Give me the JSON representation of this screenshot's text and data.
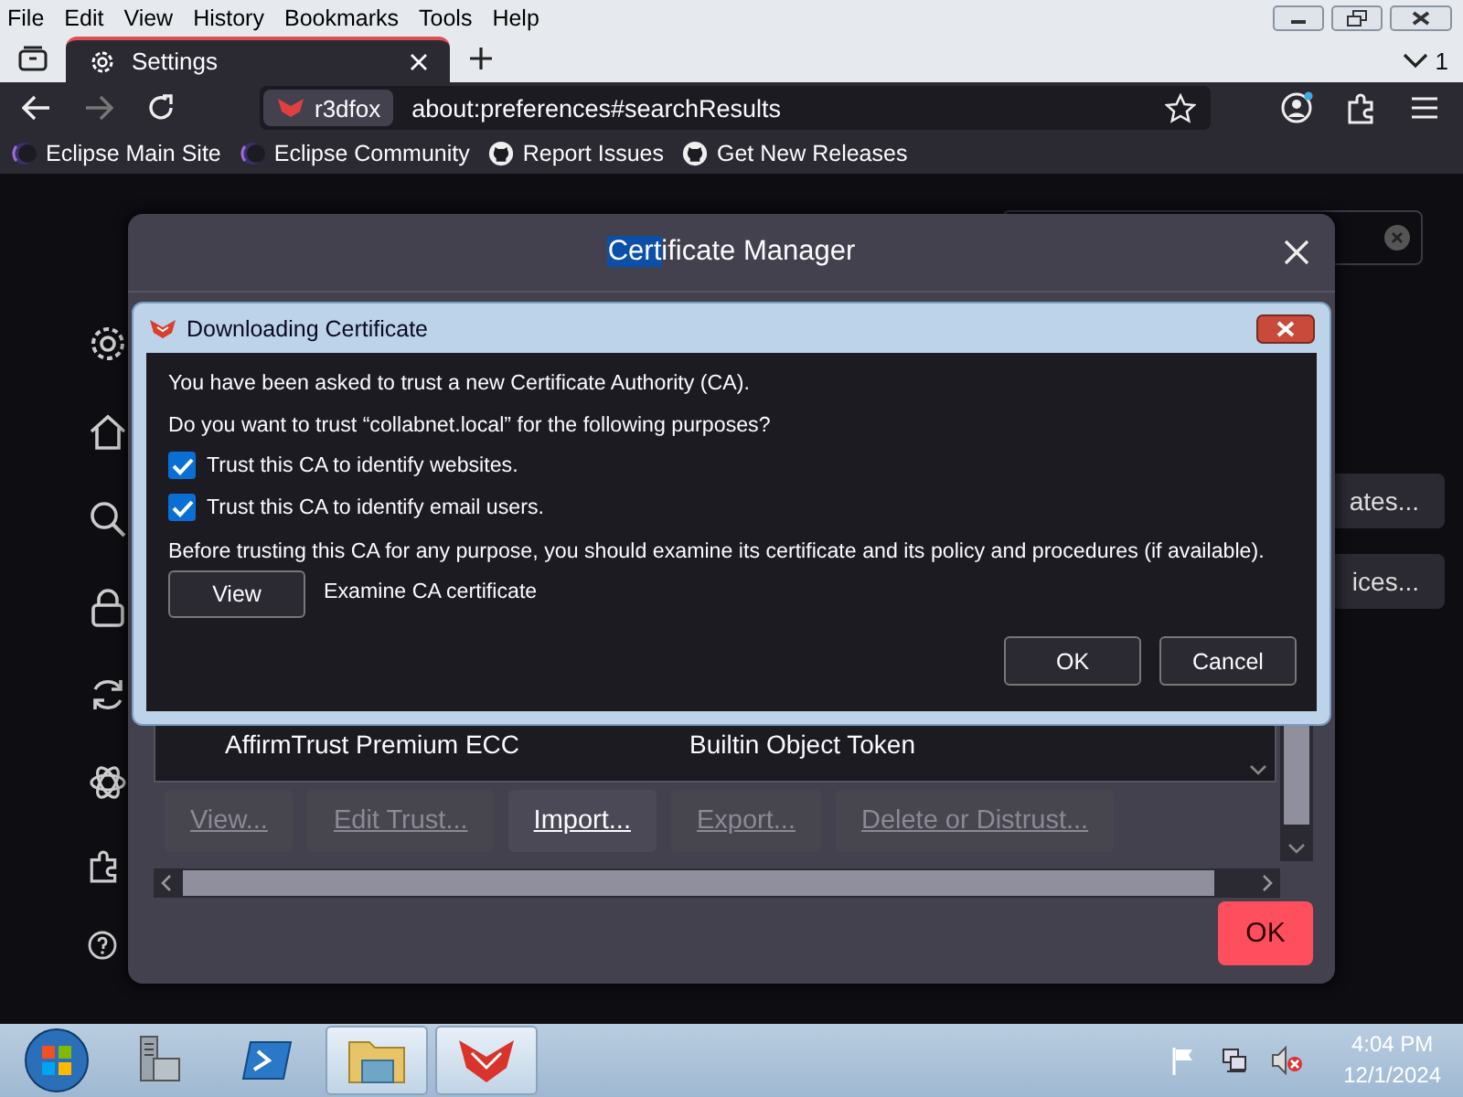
{
  "menu_bar": [
    "File",
    "Edit",
    "View",
    "History",
    "Bookmarks",
    "Tools",
    "Help"
  ],
  "tabs": [
    {
      "label": "Settings",
      "selected": true
    }
  ],
  "tab_count": "1",
  "nav": {
    "identity": "r3dfox",
    "url": "about:preferences#searchResults"
  },
  "bookmarks": [
    {
      "label": "Eclipse Main Site",
      "kind": "eclipse"
    },
    {
      "label": "Eclipse Community",
      "kind": "eclipse"
    },
    {
      "label": "Report Issues",
      "kind": "github"
    },
    {
      "label": "Get New Releases",
      "kind": "github"
    }
  ],
  "background": {
    "partial_buttons": [
      "ates...",
      "ices..."
    ]
  },
  "certificate_manager": {
    "title_parts": [
      {
        "text": "Cert",
        "selected": true
      },
      {
        "text": "ificate Manager",
        "selected": false
      }
    ],
    "rows": [
      {
        "name": "AffirmTrust Premium ECC",
        "device": "Builtin Object Token"
      }
    ],
    "buttons": [
      {
        "label": "View...",
        "disabled": true
      },
      {
        "label": "Edit Trust...",
        "disabled": true
      },
      {
        "label": "Import...",
        "disabled": false
      },
      {
        "label": "Export...",
        "disabled": true
      },
      {
        "label": "Delete or Distrust...",
        "disabled": true
      }
    ],
    "ok": "OK"
  },
  "download_dialog": {
    "title": "Downloading Certificate",
    "lines": [
      "You have been asked to trust a new Certificate Authority (CA).",
      "Do you want to trust “collabnet.local” for the following purposes?"
    ],
    "checkboxes": [
      {
        "label": "Trust this CA to identify websites.",
        "checked": true
      },
      {
        "label": "Trust this CA to identify email users.",
        "checked": true
      }
    ],
    "note": "Before trusting this CA for any purpose, you should examine its certificate and its policy and procedures (if available).",
    "view_button": "View",
    "view_label": "Examine CA certificate",
    "buttons": [
      "OK",
      "Cancel"
    ]
  },
  "taskbar": {
    "time": "4:04 PM",
    "date": "12/1/2024"
  }
}
